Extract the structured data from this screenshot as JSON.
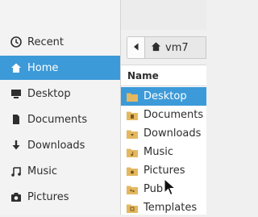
{
  "sidebar": {
    "items": [
      {
        "label": "Recent",
        "icon": "clock-icon"
      },
      {
        "label": "Home",
        "icon": "home-icon"
      },
      {
        "label": "Desktop",
        "icon": "monitor-icon"
      },
      {
        "label": "Documents",
        "icon": "document-icon"
      },
      {
        "label": "Downloads",
        "icon": "download-arrow-icon"
      },
      {
        "label": "Music",
        "icon": "music-note-icon"
      },
      {
        "label": "Pictures",
        "icon": "camera-icon"
      }
    ],
    "active": "Home"
  },
  "pathbar": {
    "back_icon": "chevron-left-icon",
    "crumb_label": "vm7",
    "crumb_icon": "home-icon"
  },
  "file_list": {
    "column_header": "Name",
    "rows": [
      {
        "name": "Desktop",
        "icon": "folder-icon",
        "selected": true
      },
      {
        "name": "Documents",
        "icon": "folder-documents-icon"
      },
      {
        "name": "Downloads",
        "icon": "folder-download-icon"
      },
      {
        "name": "Music",
        "icon": "folder-music-icon"
      },
      {
        "name": "Pictures",
        "icon": "folder-pictures-icon"
      },
      {
        "name": "Pub",
        "icon": "folder-public-icon"
      },
      {
        "name": "Templates",
        "icon": "folder-templates-icon"
      }
    ]
  },
  "colors": {
    "accent": "#3c9ad8",
    "folder": "#e4b860",
    "folder_dark": "#b5873a"
  }
}
